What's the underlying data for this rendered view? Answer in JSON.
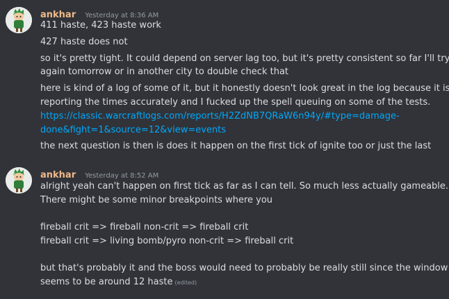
{
  "colors": {
    "background": "#313338",
    "text": "#dbdee1",
    "username": "#f0b989",
    "timestamp": "#949ba4",
    "link": "#00a8fc"
  },
  "messages": [
    {
      "username": "ankhar",
      "timestamp": "Yesterday at 8:36 AM",
      "avatar_icon": "cartoon-character-avatar-icon",
      "lines": [
        "411 haste, 423 haste work",
        "427 haste does not",
        "so it's pretty tight. It could depend on server lag too, but it's pretty consistent so far I'll try",
        "again tomorrow or in another city to double check that",
        "here is kind of a log of some of it, but it honestly doesn't look great in the log because it isn't",
        "reporting the times accurately and I fucked up the spell queuing on some of the tests.",
        "https://classic.warcraftlogs.com/reports/H2ZdNB7QRaW6n94y/#type=damage-",
        "done&fight=1&source=12&view=events",
        "the next question is then is does it happen on the first tick of ignite too or just the last"
      ]
    },
    {
      "username": "ankhar",
      "timestamp": "Yesterday at 8:52 AM",
      "avatar_icon": "cartoon-character-avatar-icon",
      "lines": [
        "alright yeah can't happen on first tick as far as I can tell. So much less actually gameable.",
        "There might be some minor breakpoints where you",
        "fireball crit => fireball non-crit => fireball crit",
        "fireball crit => living bomb/pyro non-crit => fireball crit",
        "but that's probably it and the boss would need to probably be really still since the window",
        "seems to be around 12 haste"
      ],
      "edited_label": "(edited)"
    }
  ]
}
